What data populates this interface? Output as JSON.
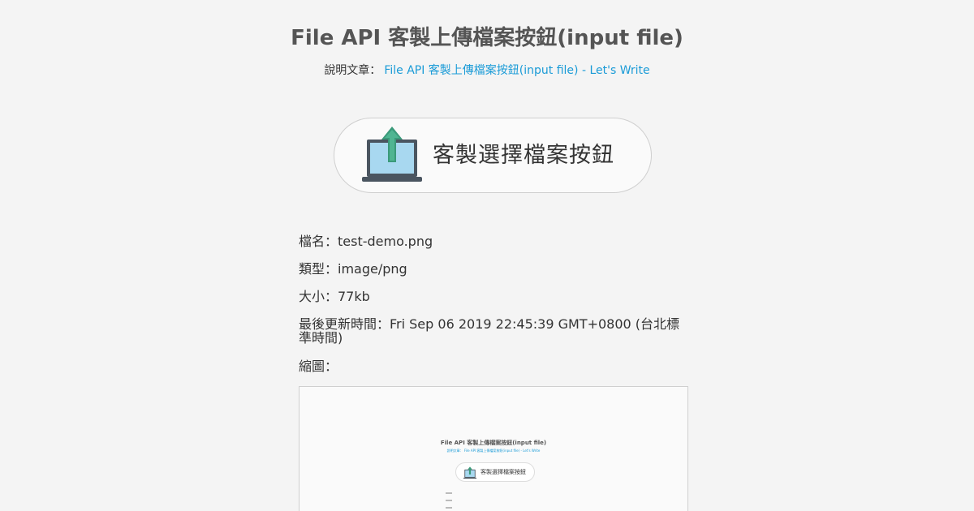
{
  "header": {
    "title": "File API 客製上傳檔案按鈕(input file)",
    "article_prefix": "說明文章：",
    "article_link": "File API 客製上傳檔案按鈕(input file) - Let's Write"
  },
  "upload_button": {
    "label": "客製選擇檔案按鈕",
    "icon": "laptop-upload-icon"
  },
  "file_info": {
    "name": "檔名：test-demo.png",
    "type": "類型：image/png",
    "size": "大小：77kb",
    "modified": "最後更新時間：Fri Sep 06 2019 22:45:39 GMT+0800 (台北標準時間)",
    "thumbnail_label": "縮圖："
  },
  "thumbnail": {
    "title": "File API 客製上傳檔案按鈕(input file)",
    "subtitle": "說明文章： File API 客製上傳檔案按鈕(input file) - Let's Write",
    "button_label": "客製選擇檔案按鈕"
  },
  "colors": {
    "background": "#f4f4f4",
    "link": "#1a9bd7",
    "title": "#555555",
    "laptop_screen": "#a8d8f0",
    "laptop_frame": "#4a5560",
    "arrow": "#3a9a7a"
  }
}
